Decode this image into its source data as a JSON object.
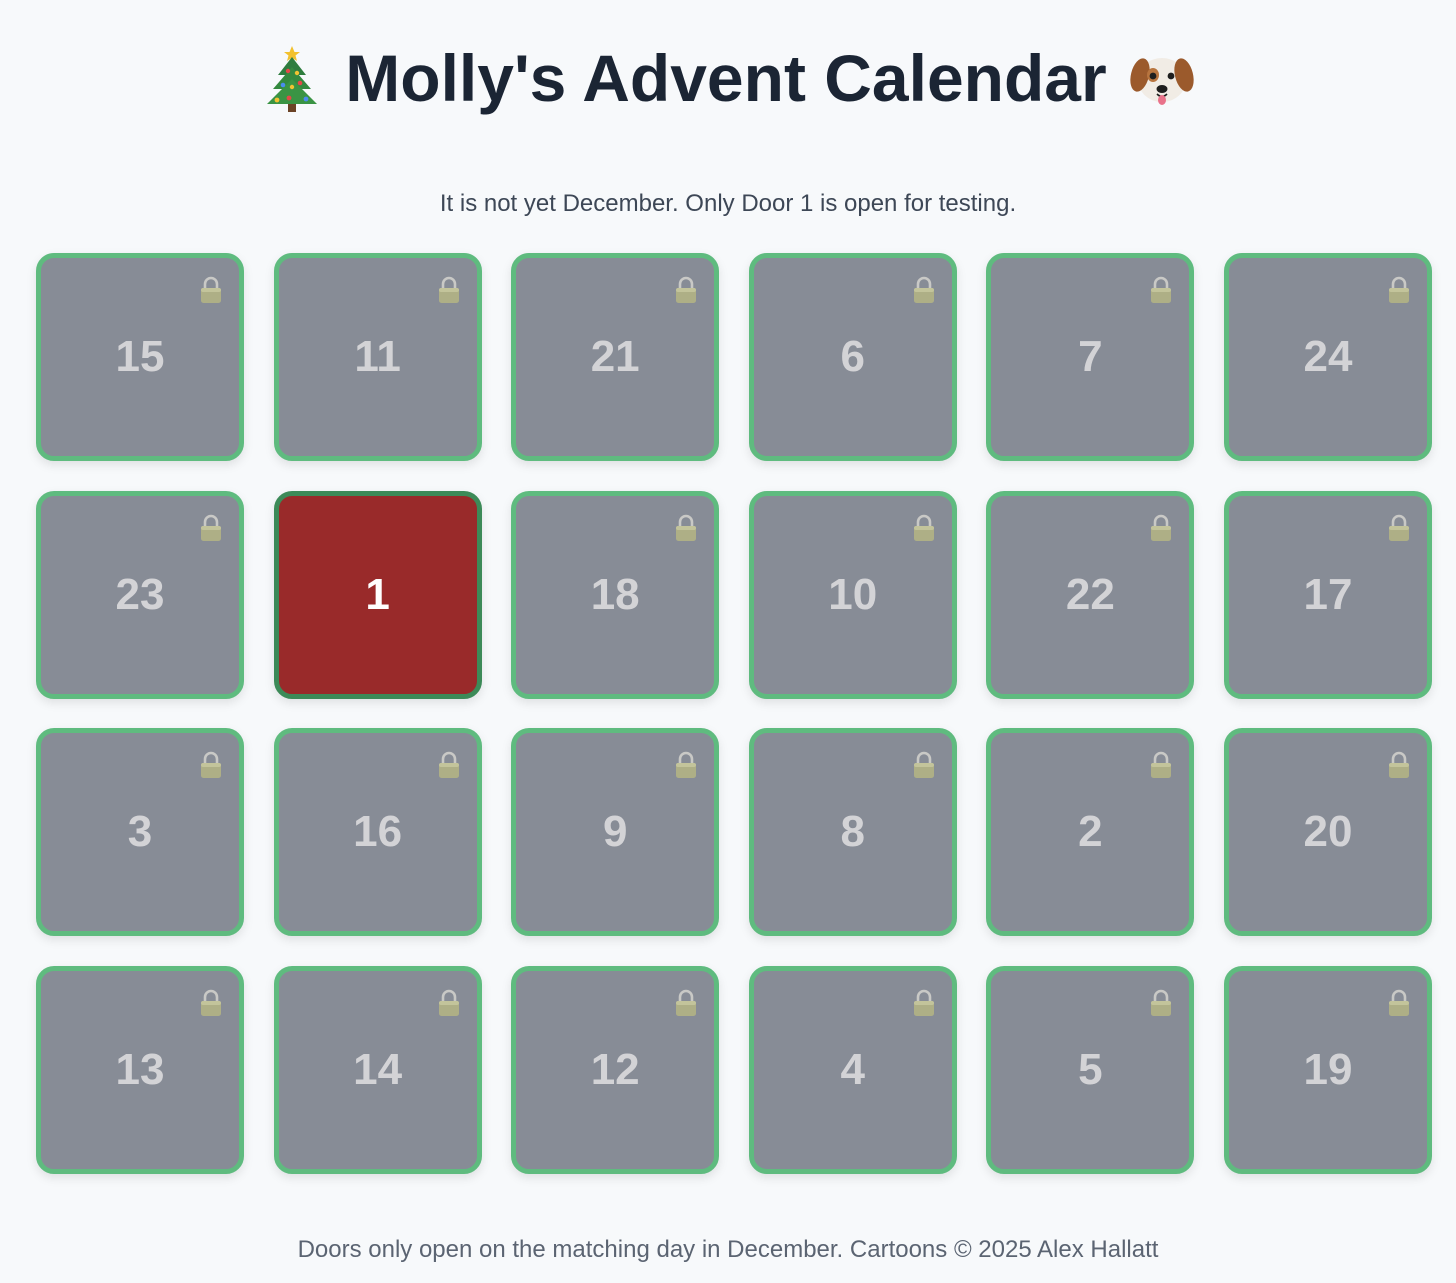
{
  "header": {
    "title": "Molly's Advent Calendar",
    "left_icon": "christmas-tree-icon",
    "right_icon": "dog-face-icon"
  },
  "status_text": "It is not yet December. Only Door 1 is open for testing.",
  "doors": [
    {
      "number": "15",
      "state": "locked"
    },
    {
      "number": "11",
      "state": "locked"
    },
    {
      "number": "21",
      "state": "locked"
    },
    {
      "number": "6",
      "state": "locked"
    },
    {
      "number": "7",
      "state": "locked"
    },
    {
      "number": "24",
      "state": "locked"
    },
    {
      "number": "23",
      "state": "locked"
    },
    {
      "number": "1",
      "state": "open"
    },
    {
      "number": "18",
      "state": "locked"
    },
    {
      "number": "10",
      "state": "locked"
    },
    {
      "number": "22",
      "state": "locked"
    },
    {
      "number": "17",
      "state": "locked"
    },
    {
      "number": "3",
      "state": "locked"
    },
    {
      "number": "16",
      "state": "locked"
    },
    {
      "number": "9",
      "state": "locked"
    },
    {
      "number": "8",
      "state": "locked"
    },
    {
      "number": "2",
      "state": "locked"
    },
    {
      "number": "20",
      "state": "locked"
    },
    {
      "number": "13",
      "state": "locked"
    },
    {
      "number": "14",
      "state": "locked"
    },
    {
      "number": "12",
      "state": "locked"
    },
    {
      "number": "4",
      "state": "locked"
    },
    {
      "number": "5",
      "state": "locked"
    },
    {
      "number": "19",
      "state": "locked"
    }
  ],
  "footer_text": "Doors only open on the matching day in December. Cartoons © 2025 Alex Hallatt",
  "colors": {
    "background": "#f7f9fb",
    "title": "#1b2534",
    "door_locked": "#878c96",
    "door_open": "#992a2a",
    "door_border": "#5fbb7f",
    "door_open_border": "#3c8a58"
  }
}
